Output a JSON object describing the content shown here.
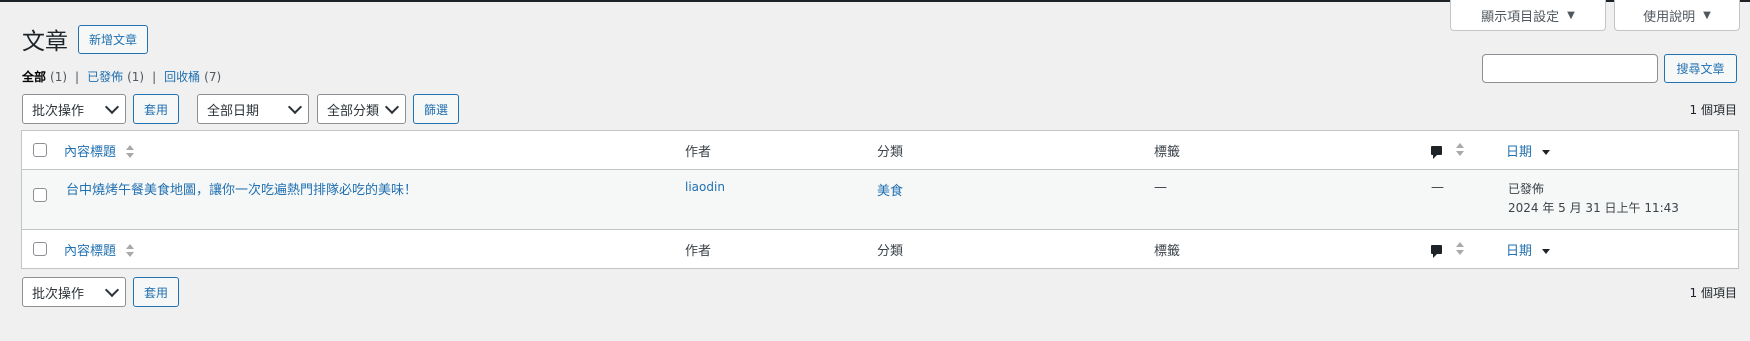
{
  "screen_options": {
    "label": "顯示項目設定",
    "arrow": "▼"
  },
  "help": {
    "label": "使用說明",
    "arrow": "▼"
  },
  "page": {
    "title": "文章",
    "add_new": "新增文章"
  },
  "views": [
    {
      "label": "全部",
      "count": "(1)"
    },
    {
      "label": "已發佈",
      "count": "(1)"
    },
    {
      "label": "回收桶",
      "count": "(7)"
    }
  ],
  "views_sep": "|",
  "search": {
    "button": "搜尋文章",
    "value": ""
  },
  "tablenav": {
    "bulk_action": "批次操作",
    "apply": "套用",
    "date_filter": "全部日期",
    "category_filter": "全部分類",
    "filter": "篩選",
    "items": "1 個項目"
  },
  "columns": {
    "title": "內容標題",
    "author": "作者",
    "categories": "分類",
    "tags": "標籤",
    "date": "日期"
  },
  "posts": [
    {
      "title": "台中燒烤午餐美食地圖，讓你一次吃遍熱門排隊必吃的美味！",
      "author": "liaodin",
      "category": "美食",
      "tags": "—",
      "comments": "—",
      "status": "已發佈",
      "date": "2024 年 5 月 31 日上午 11:43"
    }
  ]
}
